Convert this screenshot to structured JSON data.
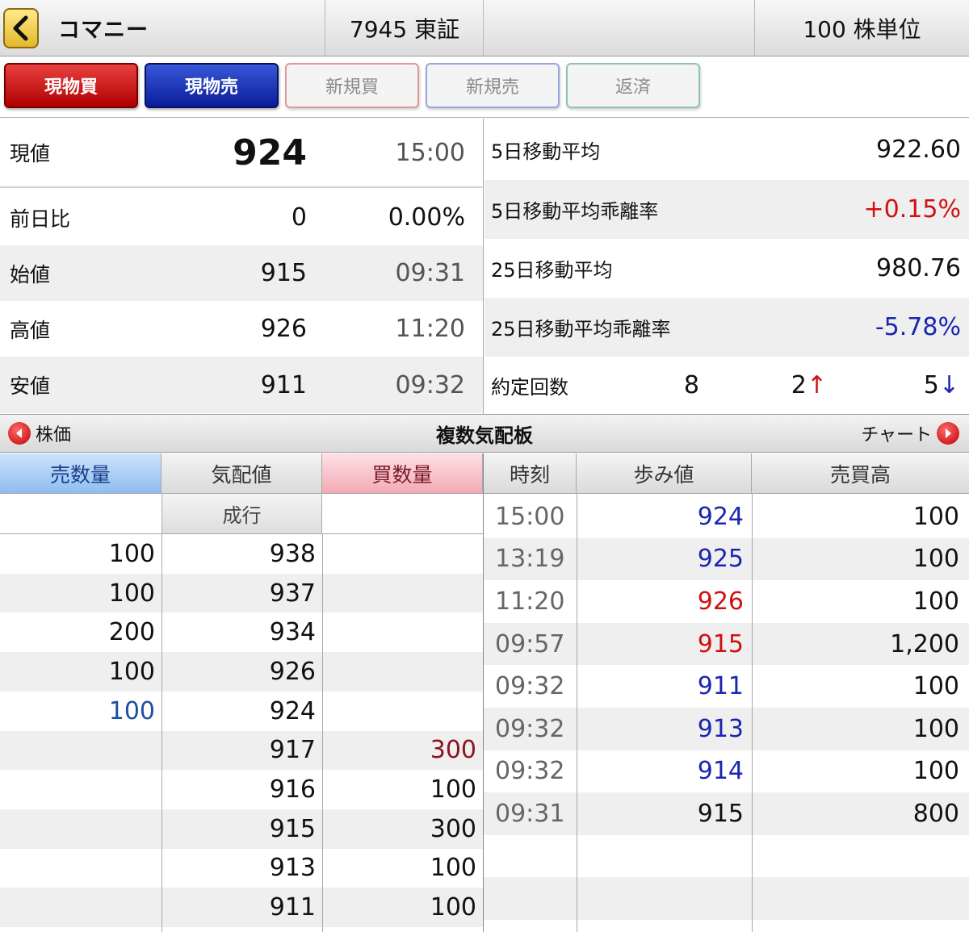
{
  "header": {
    "company": "コマニー",
    "code_market": "7945 東証",
    "unit": "100 株単位"
  },
  "order_buttons": {
    "buy": "現物買",
    "sell": "現物売",
    "new_buy": "新規買",
    "new_sell": "新規売",
    "repay": "返済"
  },
  "quote": [
    {
      "label": "現値",
      "value": "924",
      "sub": "15:00"
    },
    {
      "label": "前日比",
      "value": "0",
      "sub": "0.00%"
    },
    {
      "label": "始値",
      "value": "915",
      "sub": "09:31"
    },
    {
      "label": "高値",
      "value": "926",
      "sub": "11:20"
    },
    {
      "label": "安値",
      "value": "911",
      "sub": "09:32"
    }
  ],
  "indicators": [
    {
      "label": "5日移動平均",
      "value": "922.60"
    },
    {
      "label": "5日移動平均乖離率",
      "value": "+0.15%"
    },
    {
      "label": "25日移動平均",
      "value": "980.76"
    },
    {
      "label": "25日移動平均乖離率",
      "value": "-5.78%"
    }
  ],
  "trades": {
    "label": "約定回数",
    "total": "8",
    "up": "2↑",
    "down": "5↓"
  },
  "section": {
    "left": "株価",
    "title": "複数気配板",
    "right": "チャート"
  },
  "board": {
    "headers": {
      "sell_qty": "売数量",
      "price": "気配値",
      "buy_qty": "買数量"
    },
    "market_order": "成行",
    "rows": [
      {
        "sell": "100",
        "price": "938",
        "buy": ""
      },
      {
        "sell": "100",
        "price": "937",
        "buy": ""
      },
      {
        "sell": "200",
        "price": "934",
        "buy": ""
      },
      {
        "sell": "100",
        "price": "926",
        "buy": ""
      },
      {
        "sell": "100",
        "price": "924",
        "buy": ""
      },
      {
        "sell": "",
        "price": "917",
        "buy": "300"
      },
      {
        "sell": "",
        "price": "916",
        "buy": "100"
      },
      {
        "sell": "",
        "price": "915",
        "buy": "300"
      },
      {
        "sell": "",
        "price": "913",
        "buy": "100"
      },
      {
        "sell": "",
        "price": "911",
        "buy": "100"
      }
    ]
  },
  "ticks": {
    "headers": {
      "time": "時刻",
      "price": "歩み値",
      "volume": "売買高"
    },
    "rows": [
      {
        "time": "15:00",
        "price": "924",
        "volume": "100",
        "color": "#1a26b0"
      },
      {
        "time": "13:19",
        "price": "925",
        "volume": "100",
        "color": "#1a26b0"
      },
      {
        "time": "11:20",
        "price": "926",
        "volume": "100",
        "color": "#d01010"
      },
      {
        "time": "09:57",
        "price": "915",
        "volume": "1,200",
        "color": "#d01010"
      },
      {
        "time": "09:32",
        "price": "911",
        "volume": "100",
        "color": "#1a26b0"
      },
      {
        "time": "09:32",
        "price": "913",
        "volume": "100",
        "color": "#1a26b0"
      },
      {
        "time": "09:32",
        "price": "914",
        "volume": "100",
        "color": "#1a26b0"
      },
      {
        "time": "09:31",
        "price": "915",
        "volume": "800",
        "color": "#111111"
      }
    ]
  }
}
